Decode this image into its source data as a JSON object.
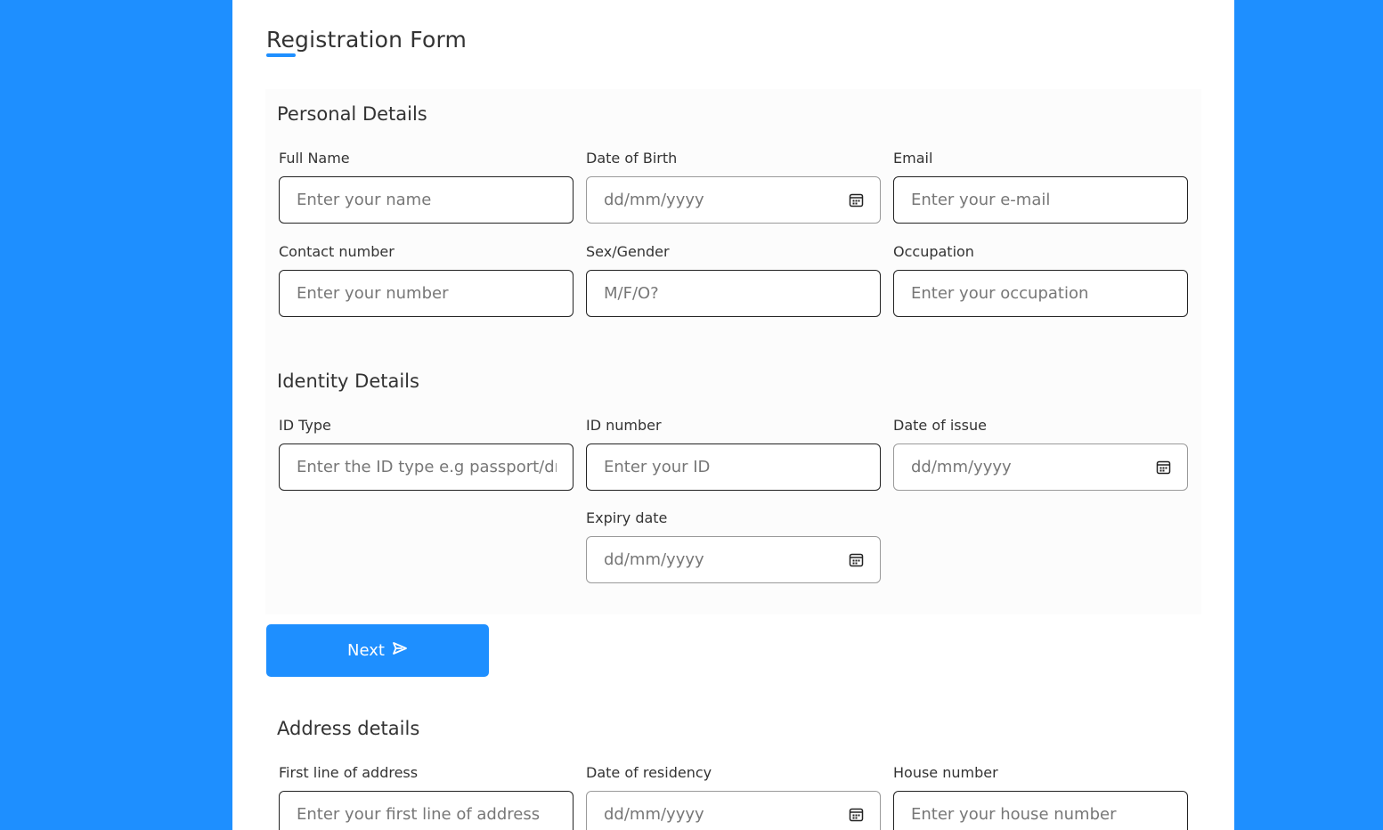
{
  "title": "Registration Form",
  "colors": {
    "accent": "#1e8fff",
    "page_background": "#1e8fff",
    "panel": "#fcfcfc"
  },
  "personal": {
    "heading": "Personal Details",
    "full_name": {
      "label": "Full Name",
      "placeholder": "Enter your name"
    },
    "dob": {
      "label": "Date of Birth",
      "placeholder": "dd/mm/yyyy",
      "icon": "calendar-icon"
    },
    "email": {
      "label": "Email",
      "placeholder": "Enter your e-mail"
    },
    "contact": {
      "label": "Contact number",
      "placeholder": "Enter your number"
    },
    "gender": {
      "label": "Sex/Gender",
      "placeholder": "M/F/O?"
    },
    "occupation": {
      "label": "Occupation",
      "placeholder": "Enter your occupation"
    }
  },
  "identity": {
    "heading": "Identity Details",
    "id_type": {
      "label": "ID Type",
      "placeholder": "Enter the ID type e.g passport/dri"
    },
    "id_number": {
      "label": "ID number",
      "placeholder": "Enter your ID"
    },
    "issue_date": {
      "label": "Date of issue",
      "placeholder": "dd/mm/yyyy",
      "icon": "calendar-icon"
    },
    "expiry_date": {
      "label": "Expiry date",
      "placeholder": "dd/mm/yyyy",
      "icon": "calendar-icon"
    }
  },
  "next_button": {
    "label": "Next",
    "icon": "send-icon"
  },
  "address": {
    "heading": "Address details",
    "first_line": {
      "label": "First line of address",
      "placeholder": "Enter your first line of address"
    },
    "residency_date": {
      "label": "Date of residency",
      "placeholder": "dd/mm/yyyy",
      "icon": "calendar-icon"
    },
    "house_number": {
      "label": "House number",
      "placeholder": "Enter your house number"
    }
  }
}
